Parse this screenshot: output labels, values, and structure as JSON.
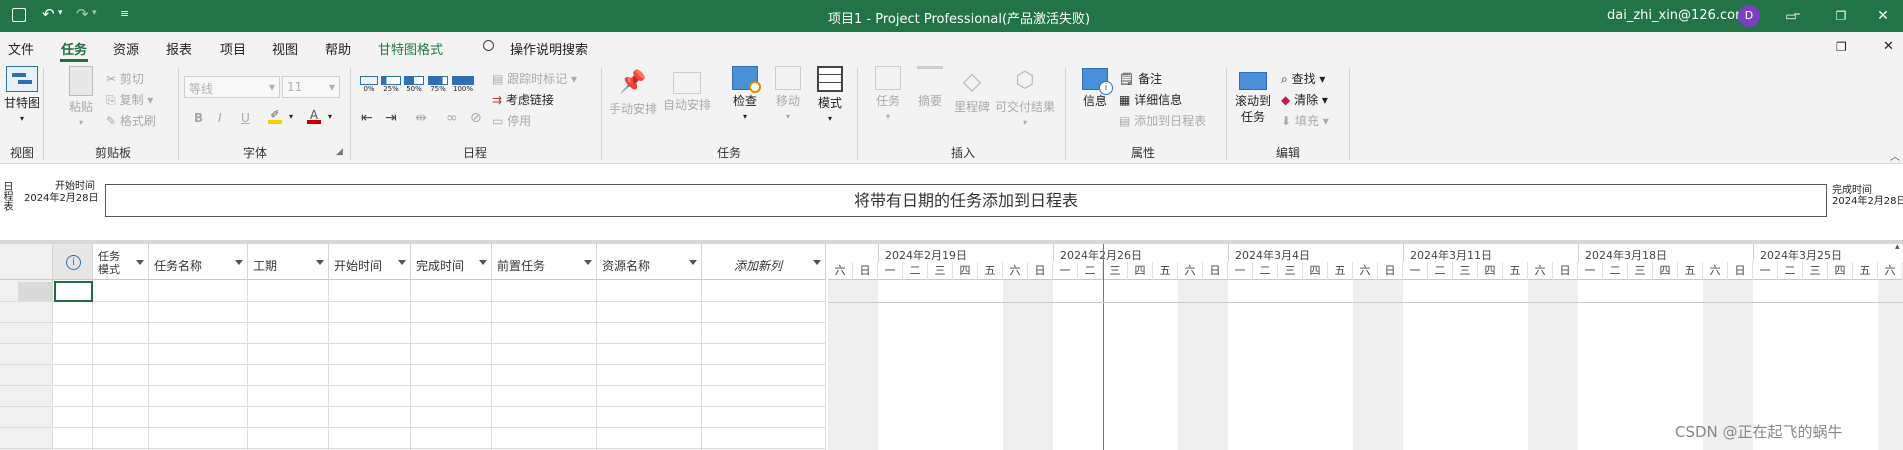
{
  "titlebar": {
    "title": "项目1  -  Project Professional(产品激活失败)",
    "user": "dai_zhi_xin@126.com",
    "avatar_letter": "D",
    "bg": "#227447"
  },
  "menu": {
    "file": "文件",
    "task": "任务",
    "resource": "资源",
    "report": "报表",
    "project": "项目",
    "view": "视图",
    "help": "帮助",
    "gantt_format": "甘特图格式",
    "search": "操作说明搜索"
  },
  "ribbon": {
    "view_group": {
      "gantt": "甘特图",
      "label": "视图"
    },
    "clipboard": {
      "paste": "粘贴",
      "cut": "剪切",
      "copy": "复制",
      "format_painter": "格式刷",
      "label": "剪贴板"
    },
    "font": {
      "font_name": "等线",
      "font_size": "11",
      "bold": "B",
      "italic": "I",
      "underline": "U",
      "font_color": "A",
      "label": "字体"
    },
    "schedule": {
      "p0": "0%",
      "p25": "25%",
      "p50": "50%",
      "p75": "75%",
      "p100": "100%",
      "track": "跟踪时标记",
      "respect_links": "考虑链接",
      "inactivate": "停用",
      "label": "日程"
    },
    "tasks": {
      "manual": "手动安排",
      "auto": "自动安排",
      "inspect": "检查",
      "move": "移动",
      "mode": "模式",
      "label": "任务"
    },
    "insert": {
      "task": "任务",
      "summary": "摘要",
      "milestone": "里程碑",
      "deliverable": "可交付结果",
      "label": "插入"
    },
    "properties": {
      "info": "信息",
      "notes": "备注",
      "details": "详细信息",
      "add_timeline": "添加到日程表",
      "label": "属性"
    },
    "editing": {
      "scroll": "滚动到",
      "scroll2": "任务",
      "find": "查找",
      "clear": "清除",
      "fill": "填充",
      "label": "编辑"
    }
  },
  "timeline": {
    "side_label": "日程表",
    "start_label": "开始时间",
    "start_date": "2024年2月28日",
    "finish_label": "完成时间",
    "finish_date": "2024年2月28日",
    "bar_text": "将带有日期的任务添加到日程表"
  },
  "grid": {
    "columns": [
      "任务模式",
      "任务名称",
      "工期",
      "开始时间",
      "完成时间",
      "前置任务",
      "资源名称",
      "添加新列"
    ],
    "mode_line1": "任务",
    "mode_line2": "模式"
  },
  "gantt": {
    "weeks": [
      "2024年2月19日",
      "2024年2月26日",
      "2024年3月4日",
      "2024年3月11日",
      "2024年3月18日",
      "2024年3月25日"
    ],
    "days_first": [
      "六",
      "日"
    ],
    "week_days": [
      "一",
      "二",
      "三",
      "四",
      "五",
      "六",
      "日"
    ],
    "last_days": [
      "一",
      "二",
      "三",
      "四",
      "五",
      "六"
    ]
  },
  "watermark": "CSDN @正在起飞的蜗牛"
}
